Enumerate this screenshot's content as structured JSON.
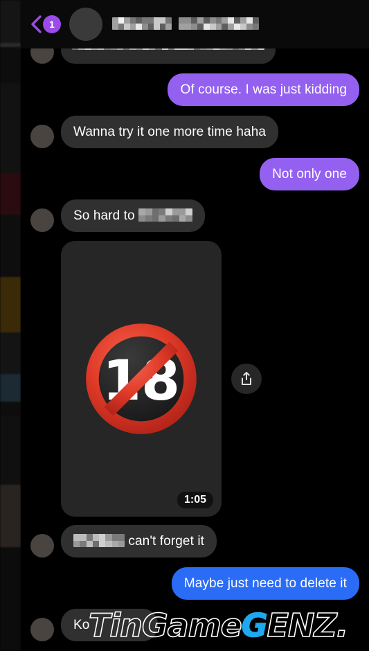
{
  "app": {
    "theme": "dark",
    "colors": {
      "background": "#000000",
      "incoming_bubble": "#303030",
      "outgoing_purple": "#9460F0",
      "outgoing_blue": "#2B6CF6",
      "accent_purple": "#9B4BE8",
      "watermark_accent": "#1FA8F0",
      "media_card": "#262626",
      "emoji_red": "#E03A28"
    }
  },
  "header": {
    "back_icon": "chevron-left-icon",
    "unread_count": "1",
    "avatar": "contact-avatar-censored",
    "contact_name": "█████ ██████",
    "contact_name_censored": true
  },
  "messages": [
    {
      "id": "m0",
      "side": "in",
      "censored": true,
      "clipped": true,
      "text": "█████ ███ █████ ████ ██",
      "avatar": true
    },
    {
      "id": "m1",
      "side": "out",
      "color": "purple",
      "text": "Of course. I was just kidding"
    },
    {
      "id": "m2",
      "side": "in",
      "color": "grey",
      "text": "Wanna try it one more time haha",
      "avatar": true
    },
    {
      "id": "m3",
      "side": "out",
      "color": "purple",
      "text": "Not only one"
    },
    {
      "id": "m4",
      "side": "in",
      "color": "grey",
      "text": "So hard to ",
      "redacted_tail": true,
      "avatar": true
    },
    {
      "id": "m5",
      "side": "in",
      "type": "media",
      "media": {
        "kind": "video-attachment",
        "overlay_emoji": "no-one-under-eighteen-emoji",
        "emoji_number": "18",
        "duration": "1:05",
        "share_icon": "share-upload-icon"
      }
    },
    {
      "id": "m6",
      "side": "in",
      "color": "grey",
      "redacted_head": true,
      "text": " can't forget it",
      "avatar": true
    },
    {
      "id": "m7",
      "side": "out",
      "color": "blue",
      "text": "Maybe just need to delete it"
    },
    {
      "id": "m8",
      "side": "in",
      "color": "grey",
      "text": "Ko",
      "avatar": true,
      "partially_covered": true
    }
  ],
  "watermark": {
    "part1": "TinGame",
    "accent": "G",
    "part2": "ENZ."
  }
}
